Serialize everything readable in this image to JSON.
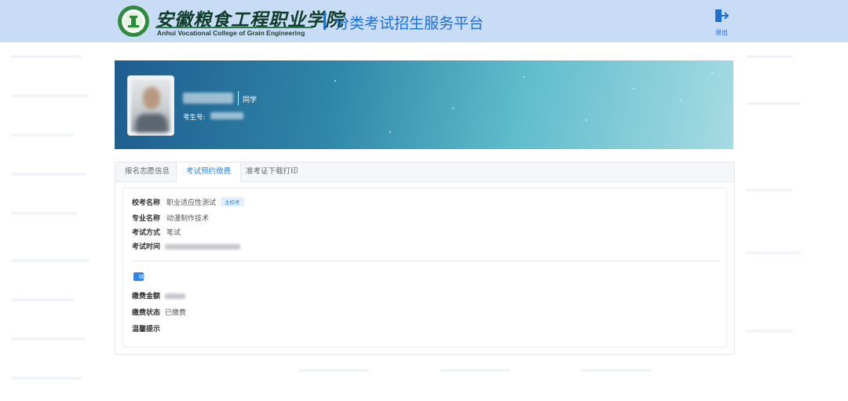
{
  "header": {
    "college_name_cn": "安徽粮食工程职业学院",
    "college_name_en": "Anhui Vocational College of Grain Engineering",
    "platform_title": "分类考试招生服务平台",
    "logout_label": "退出",
    "brand_color": "#1f6fd1"
  },
  "banner": {
    "name_suffix": "同学",
    "exam_number_label": "考生号:"
  },
  "tabs": [
    {
      "label": "报名志愿信息",
      "active": false
    },
    {
      "label": "考试预约缴费",
      "active": true
    },
    {
      "label": "准考证下载打印",
      "active": false
    }
  ],
  "exam": {
    "school_exam_label": "校考名称",
    "school_exam_value": "职业适应性测试",
    "school_exam_tag": "主校考",
    "major_label": "专业名称",
    "major_value": "动漫制作技术",
    "method_label": "考试方式",
    "method_value": "笔试",
    "time_label": "考试时间"
  },
  "payment": {
    "icon": "wallet-icon",
    "amount_label": "缴费金额",
    "status_label": "缴费状态",
    "status_value": "已缴费",
    "tips_label": "温馨提示"
  }
}
